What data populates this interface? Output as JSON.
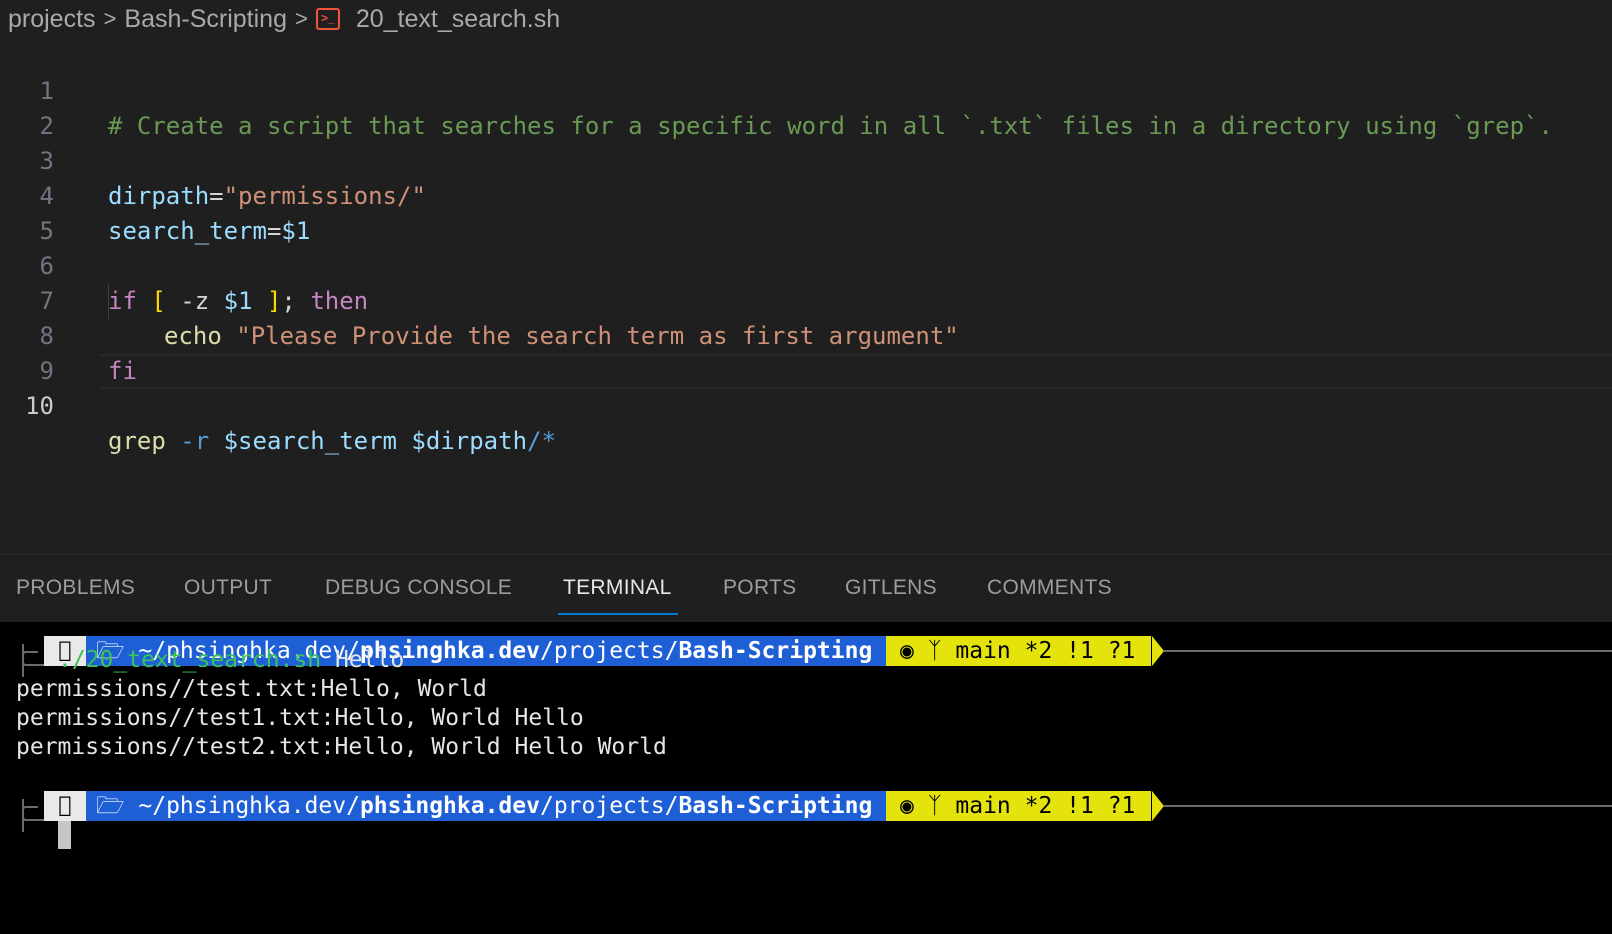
{
  "breadcrumb": {
    "items": [
      "projects",
      "Bash-Scripting",
      "20_text_search.sh"
    ],
    "separator": ">",
    "file_icon": "terminal-file-icon",
    "file_icon_color": "#f0553c"
  },
  "editor": {
    "active_line": "10",
    "line_numbers": [
      "1",
      "2",
      "3",
      "4",
      "5",
      "6",
      "7",
      "8",
      "9",
      "10"
    ],
    "tokens": {
      "l1_comment": "# Create a script that searches for a specific word in all `.txt` files in a directory using `grep`.",
      "l3_var": "dirpath",
      "l3_eq": "=",
      "l3_str": "\"permissions/\"",
      "l4_var": "search_term",
      "l4_eq": "=",
      "l4_val": "$1",
      "l6_if": "if",
      "l6_open": "[",
      "l6_flag": " -z ",
      "l6_arg": "$1",
      "l6_close": " ]",
      "l6_semi": "; ",
      "l6_then": "then",
      "l7_echo": "echo",
      "l7_str": "\"Please Provide the search term as first argument\"",
      "l8_fi": "fi",
      "l10_cmd": "grep",
      "l10_flag": " -r ",
      "l10_arg1": "$search_term",
      "l10_arg2": " $dirpath",
      "l10_glob": "/*"
    }
  },
  "panel": {
    "tabs": [
      "PROBLEMS",
      "OUTPUT",
      "DEBUG CONSOLE",
      "TERMINAL",
      "PORTS",
      "GITLENS",
      "COMMENTS"
    ],
    "active_tab": "TERMINAL"
  },
  "terminal": {
    "prompt": {
      "os_icon": "apple-icon",
      "folder_icon": "folder-icon",
      "path_prefix": "~/phsinghka.dev/",
      "path_bold1": "phsinghka.dev",
      "path_mid": "/projects/",
      "path_bold2": "Bash-Scripting",
      "git_icon": "github-icon",
      "branch_icon": "git-branch-icon",
      "git_status": "main *2 !1 ?1",
      "path_color": "#1e5fd6",
      "git_color": "#e4e40c"
    },
    "command": "./20_text_search.sh",
    "command_arg": " Hello",
    "output": [
      "permissions//test.txt:Hello, World",
      "permissions//test1.txt:Hello, World Hello",
      "permissions//test2.txt:Hello, World Hello World"
    ]
  }
}
